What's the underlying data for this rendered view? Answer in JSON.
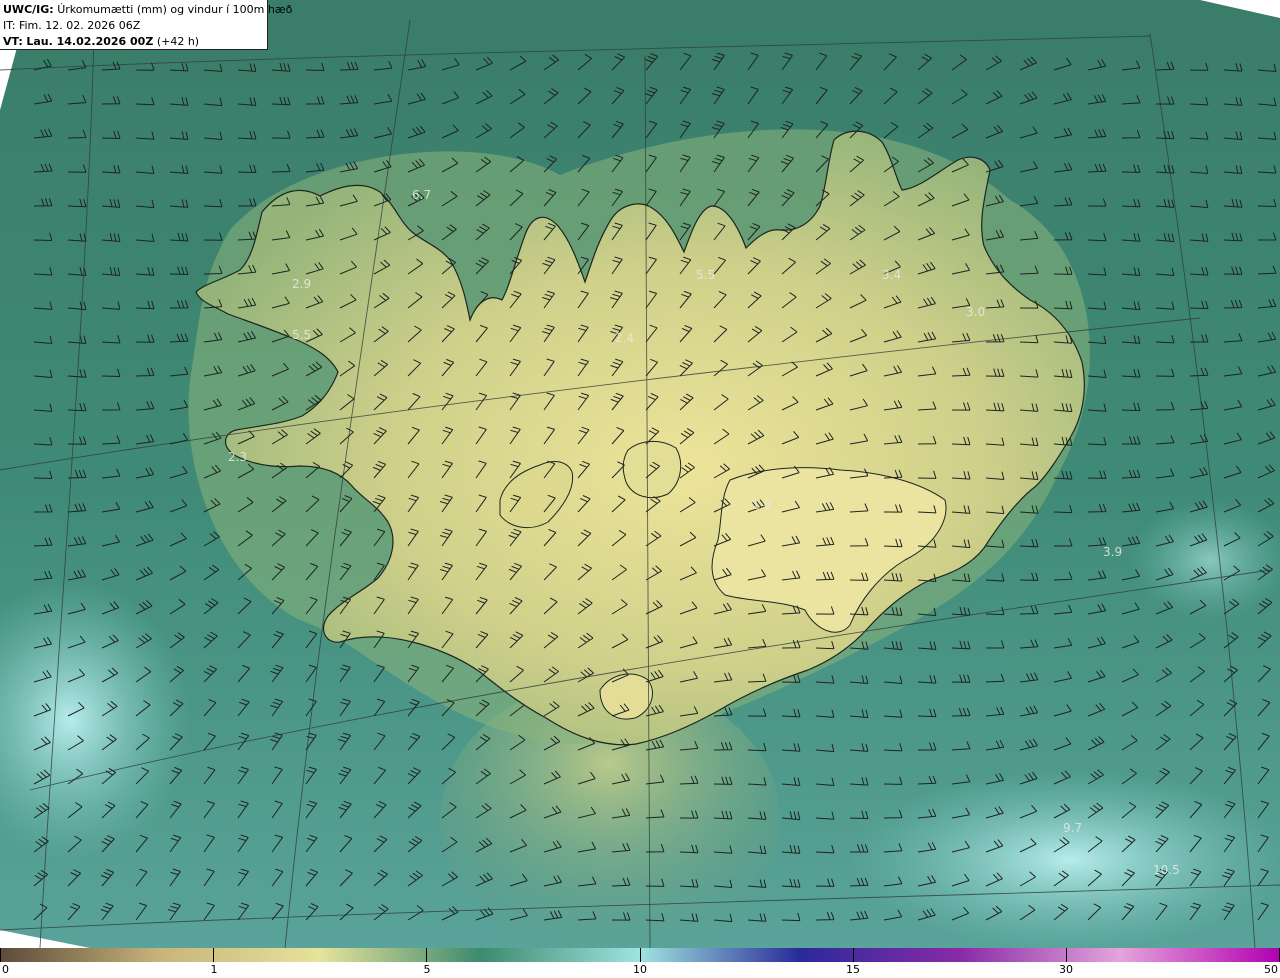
{
  "header": {
    "model_tag": "UWC/IG:",
    "title": "Úrkomumætti (mm) og vindur í 100m hæð",
    "init_time": "IT: Fim. 12. 02. 2026 06Z",
    "valid_prefix": "VT:",
    "valid_time": "Lau. 14.02.2026 00Z",
    "lead": "(+42 h)"
  },
  "map_labels": [
    {
      "text": "6.7"
    },
    {
      "text": "2.9"
    },
    {
      "text": "5.5"
    },
    {
      "text": "5.5"
    },
    {
      "text": "3.4"
    },
    {
      "text": "3.0"
    },
    {
      "text": "2.4"
    },
    {
      "text": "2.3"
    },
    {
      "text": "1.0"
    },
    {
      "text": "3.9"
    },
    {
      "text": "9.7"
    },
    {
      "text": "10.5"
    }
  ],
  "colors": {
    "ocean": "#3f8a78",
    "land_low": "#c9cf86",
    "land_high": "#e6e29a",
    "coast": "#1c2620",
    "grid": "#2f3d3a",
    "barb": "#1d2420"
  },
  "legend": {
    "ticks": [
      "0",
      "1",
      "5",
      "10",
      "15",
      "30",
      "50"
    ],
    "stops": [
      "#5c4b3a",
      "#c8b47a",
      "#e6e39a",
      "#3d8a6e",
      "#9fe3e0",
      "#2a2a9a",
      "#8a2aa8",
      "#e4a4dc",
      "#b000b0"
    ]
  }
}
